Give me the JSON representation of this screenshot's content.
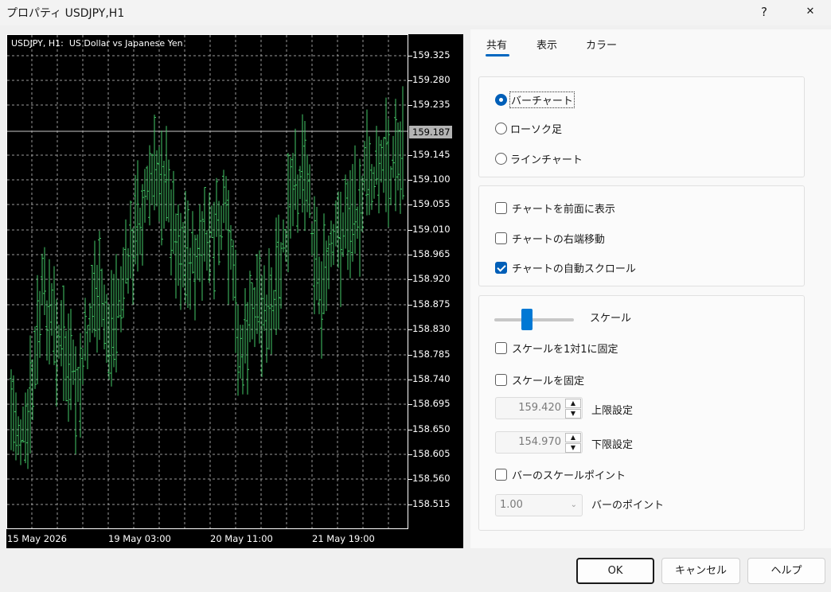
{
  "window": {
    "title": "プロパティ USDJPY,H1",
    "help_label": "?",
    "close_label": "✕"
  },
  "chart": {
    "info_text": "USDJPY, H1:  US Dollar vs Japanese Yen",
    "current_price": "159.187",
    "price_labels": [
      "159.325",
      "159.280",
      "159.235",
      "159.145",
      "159.100",
      "159.055",
      "159.010",
      "158.965",
      "158.920",
      "158.875",
      "158.830",
      "158.785",
      "158.740",
      "158.695",
      "158.650",
      "158.605",
      "158.560",
      "158.515"
    ],
    "time_labels": [
      "15 May 2026",
      "19 May 03:00",
      "20 May 11:00",
      "21 May 19:00"
    ],
    "bar_color": "#44c767"
  },
  "tabs": {
    "common": "共有",
    "display": "表示",
    "color": "カラー"
  },
  "chart_type": {
    "bar_chart": "バーチャート",
    "candlestick": "ローソク足",
    "line_chart": "ラインチャート"
  },
  "options": {
    "chart_foreground": "チャートを前面に表示",
    "chart_shift": "チャートの右端移動",
    "chart_autoscroll": "チャートの自動スクロール"
  },
  "scale": {
    "label": "スケール",
    "fix_one_to_one": "スケールを1対1に固定",
    "fix_scale": "スケールを固定",
    "upper_value": "159.420",
    "upper_label": "上限設定",
    "lower_value": "154.970",
    "lower_label": "下限設定",
    "bar_scale_points": "バーのスケールポイント",
    "points_value": "1.00",
    "points_label": "バーのポイント"
  },
  "buttons": {
    "ok": "OK",
    "cancel": "キャンセル",
    "help": "ヘルプ"
  }
}
